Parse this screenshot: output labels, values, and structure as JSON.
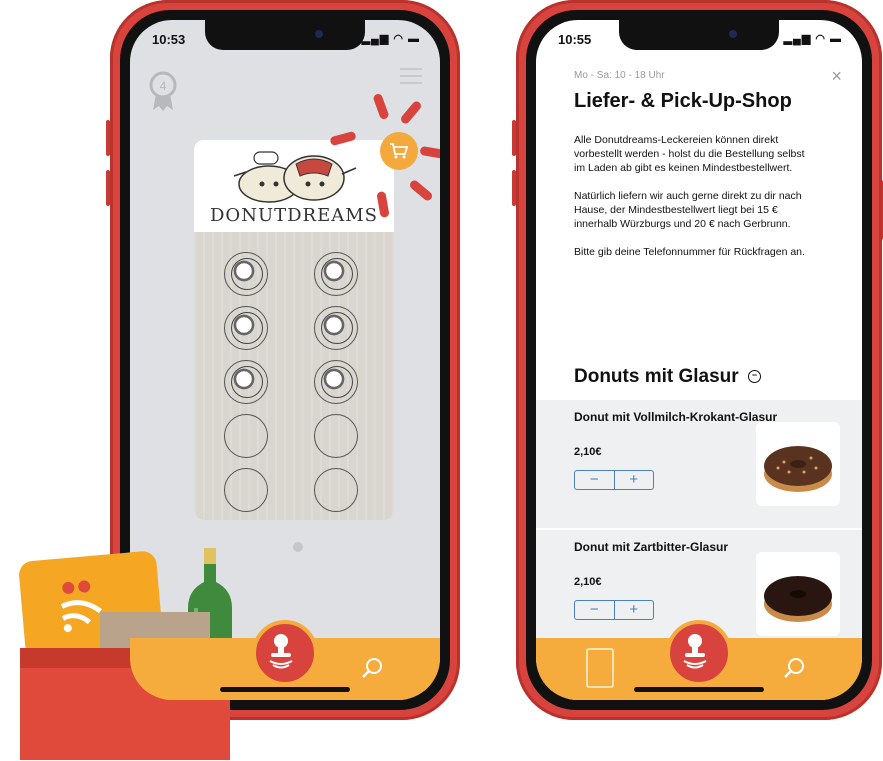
{
  "left_phone": {
    "time": "10:53",
    "status_icons": "signal wifi battery",
    "badge_number": "4",
    "brand": "DONUTDREAMS",
    "stamps_filled": 6,
    "stamps_total": 10,
    "icons": [
      "award-badge-icon",
      "menu-icon",
      "cart-icon",
      "stamp-icon",
      "search-icon"
    ]
  },
  "right_phone": {
    "time": "10:55",
    "status_icons": "signal wifi battery",
    "hours": "Mo - Sa: 10 - 18 Uhr",
    "close": "×",
    "title": "Liefer- & Pick-Up-Shop",
    "paragraphs": [
      "Alle Donutdreams-Leckereien können direkt vorbestellt werden - holst du die Bestellung selbst im Laden ab gibt es keinen Mindestbestellwert.",
      "Natürlich liefern wir auch gerne direkt zu dir nach Hause, der Mindestbestellwert liegt bei 15 € innerhalb Würzburgs und 20 € nach Gerbrunn.",
      "Bitte gib deine Telefonnummer für Rückfragen an."
    ],
    "section_title": "Donuts mit Glasur",
    "section_toggle": "−",
    "products": [
      {
        "name": "Donut mit Vollmilch-Krokant-Glasur",
        "price": "2,10€",
        "minus": "−",
        "plus": "+"
      },
      {
        "name": "Donut mit Zartbitter-Glasur",
        "price": "2,10€",
        "minus": "−",
        "plus": "+"
      }
    ]
  },
  "colors": {
    "accent_orange": "#f6ac3d",
    "accent_red": "#d8443d",
    "stepper_blue": "#4a7fc1"
  }
}
